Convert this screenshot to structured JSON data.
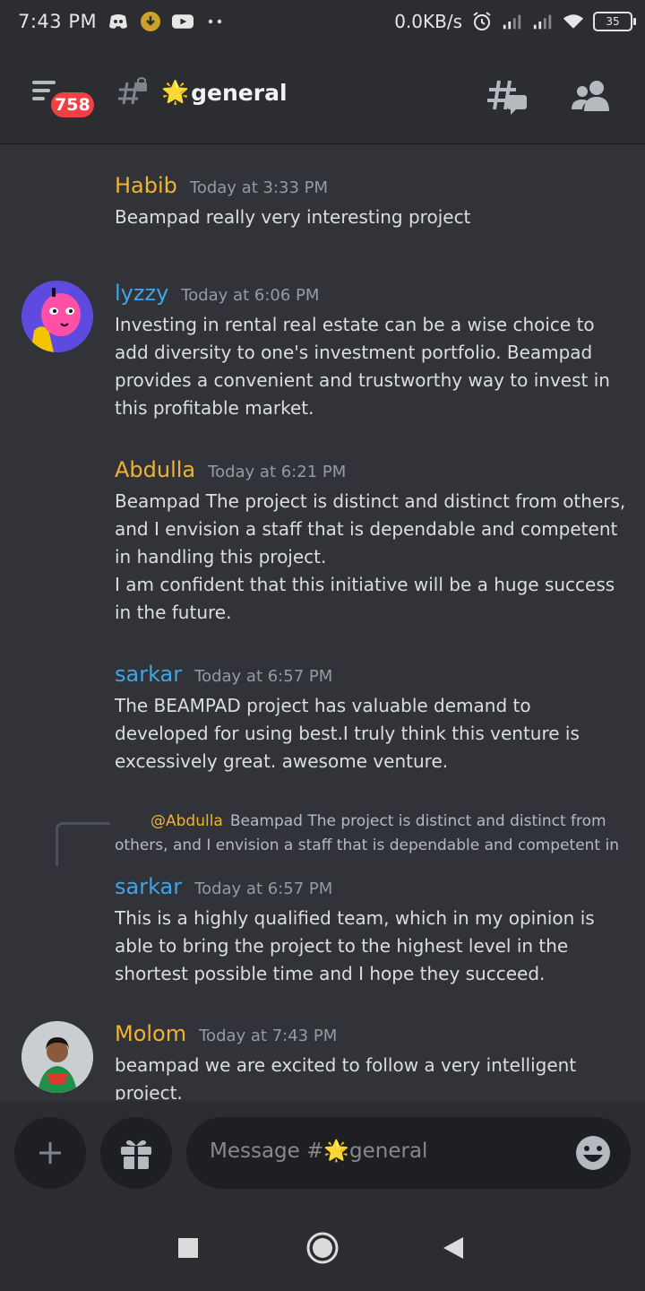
{
  "status_bar": {
    "time": "7:43 PM",
    "net_speed": "0.0KB/s",
    "battery": "35"
  },
  "header": {
    "unread_badge": "758",
    "channel_emoji": "🌟",
    "channel_name": "general"
  },
  "messages": [
    {
      "author": "Habib",
      "author_color": "#f0b232",
      "time": "Today at 3:33 PM",
      "lines": [
        "Beampad really very interesting project"
      ]
    },
    {
      "author": "lyzzy",
      "author_color": "#3ea6e6",
      "time": "Today at 6:06 PM",
      "lines": [
        "Investing in rental real estate can be a wise choice to add diversity to one's investment portfolio. Beampad provides a convenient and trustworthy way to invest in this profitable market."
      ]
    },
    {
      "author": "Abdulla",
      "author_color": "#f0b232",
      "time": "Today at 6:21 PM",
      "lines": [
        "Beampad The project is distinct and distinct from others, and I envision a staff that is dependable and competent in handling this project.",
        "I am confident that this initiative will be a huge success in the future."
      ]
    },
    {
      "author": "sarkar",
      "author_color": "#3ea6e6",
      "time": "Today at 6:57 PM",
      "lines": [
        "The BEAMPAD project has valuable demand to developed for using best.I truly think this venture is excessively great. awesome venture."
      ]
    },
    {
      "author": "sarkar",
      "author_color": "#3ea6e6",
      "time": "Today at 6:57 PM",
      "reply": {
        "mention": "@Abdulla",
        "text": "Beampad The project is distinct and distinct from others, and I envision a staff that is dependable and competent in"
      },
      "lines": [
        "This is a highly qualified team, which in my opinion is able to bring the project to the highest level in the shortest possible time and I hope they succeed."
      ]
    },
    {
      "author": "Molom",
      "author_color": "#f0b232",
      "time": "Today at 7:43 PM",
      "lines": [
        "beampad we are excited to follow a very intelligent project."
      ]
    }
  ],
  "composer": {
    "placeholder": "Message #🌟general"
  },
  "icons": {
    "menu": "menu-icon",
    "lock_channel": "locked-channel-icon",
    "threads": "threads-icon",
    "members": "members-icon",
    "add": "plus-icon",
    "gift": "gift-icon",
    "emoji": "emoji-icon",
    "recents": "square-icon",
    "home": "circle-icon",
    "back": "triangle-back-icon"
  },
  "colors": {
    "background": "#313338",
    "header": "#2b2d31",
    "badge": "#f23f43",
    "yellow_name": "#f0b232",
    "blue_name": "#3ea6e6"
  }
}
